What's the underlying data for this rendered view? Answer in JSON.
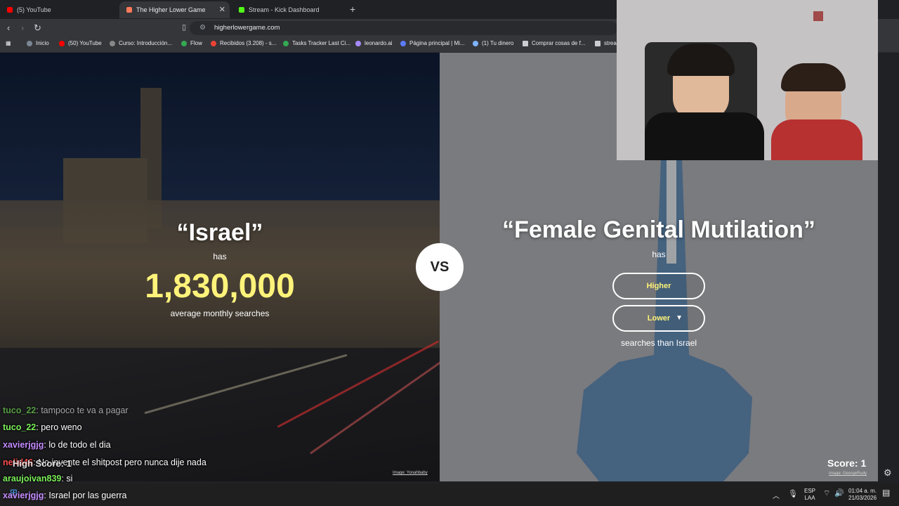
{
  "browser": {
    "tabs": [
      {
        "label": "(5) YouTube",
        "favicon_color": "#ff0000"
      },
      {
        "label": "The Higher Lower Game",
        "favicon_color": "#ff7a59"
      },
      {
        "label": "Stream - Kick Dashboard",
        "favicon_color": "#53fc18"
      }
    ],
    "tab_close": "✕",
    "new_tab": "+",
    "url": "higherlowergame.com",
    "bookmarks": [
      {
        "label": "Inicio",
        "icon_color": "#7b8794"
      },
      {
        "label": "(50) YouTube",
        "icon_color": "#ff0000"
      },
      {
        "label": "Curso: Introducción...",
        "icon_color": "#888888"
      },
      {
        "label": "Flow",
        "icon_color": "#34a853"
      },
      {
        "label": "Recibidos (3.208) - s...",
        "icon_color": "#ea4335"
      },
      {
        "label": "Tasks Tracker Last Ci...",
        "icon_color": "#34a853"
      },
      {
        "label": "leonardo.ai",
        "icon_color": "#a78bfa"
      },
      {
        "label": "Página principal | Mi...",
        "icon_color": "#5b7cfa"
      },
      {
        "label": "(1) Tu dinero",
        "icon_color": "#7fb3ff"
      },
      {
        "label": "Comprar cosas de f...",
        "icon_color": "#c9ccd1"
      },
      {
        "label": "strea",
        "icon_color": "#c9ccd1"
      }
    ]
  },
  "game": {
    "left": {
      "title": "“Israel”",
      "has": "has",
      "searches": "1,830,000",
      "caption": "average monthly searches",
      "credit": "Image: Yonahbaby"
    },
    "vs": "VS",
    "right": {
      "title": "“Female Genital Mutilation”",
      "has": "has",
      "higher_label": "Higher",
      "lower_label": "Lower",
      "lower_arrow": "▼",
      "caption": "searches than Israel",
      "credit": "Image: GeorgeRudy"
    },
    "score_label": "Score: 1",
    "high_score_label": "High Score: 1"
  },
  "chat": {
    "messages": [
      {
        "user": "tuco_22",
        "text": "tampoco te va a pagar",
        "user_color": "#7cf05a"
      },
      {
        "user": "tuco_22",
        "text": "pero weno",
        "user_color": "#7cf05a"
      },
      {
        "user": "xavierjgjg",
        "text": "lo de todo el dia",
        "user_color": "#c58cff"
      },
      {
        "user": "nelid46",
        "text": "No invente el shitpost pero nunca dije nada",
        "user_color": "#ff4f4f"
      },
      {
        "user": "araujoivan839",
        "text": "si",
        "user_color": "#7cf05a"
      },
      {
        "user": "xavierjgjg",
        "text": "Israel por las guerra",
        "user_color": "#c58cff"
      }
    ]
  },
  "taskbar": {
    "lang": "ESP",
    "lang_sub": "LAA",
    "time": "01:04 a. m.",
    "date": "21/03/2026"
  }
}
